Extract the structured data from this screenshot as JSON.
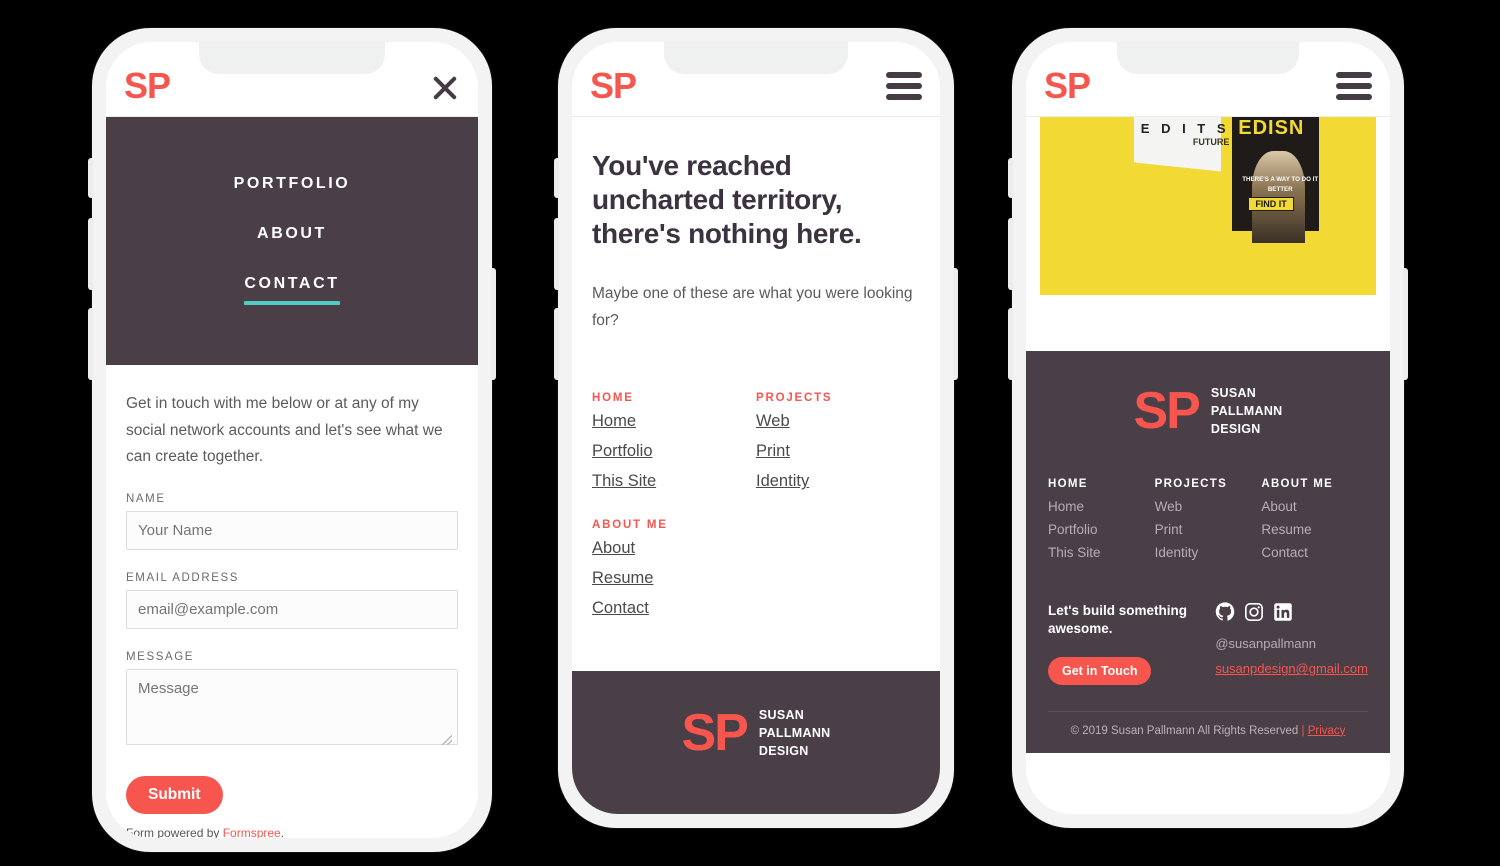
{
  "brand": {
    "logo": "SP",
    "accent": "#f7564f",
    "dark": "#4a3e47",
    "teal": "#4ecdc4",
    "name_lines": [
      "SUSAN",
      "PALLMANN",
      "DESIGN"
    ]
  },
  "phone1": {
    "header": {
      "logo": "SP",
      "close_icon": "close-icon"
    },
    "nav": {
      "items": [
        {
          "label": "PORTFOLIO",
          "active": false
        },
        {
          "label": "ABOUT",
          "active": false
        },
        {
          "label": "CONTACT",
          "active": true
        }
      ]
    },
    "contact": {
      "intro": "Get in touch with me below or at any of my social network accounts and let's see what we can create together.",
      "fields": [
        {
          "label": "NAME",
          "placeholder": "Your Name",
          "value": "",
          "type": "text"
        },
        {
          "label": "EMAIL ADDRESS",
          "placeholder": "email@example.com",
          "value": "",
          "type": "email"
        },
        {
          "label": "MESSAGE",
          "placeholder": "Message",
          "value": "",
          "type": "textarea"
        }
      ],
      "submit_label": "Submit",
      "powered_prefix": "Form powered by ",
      "powered_link": "Formspree",
      "powered_suffix": "."
    }
  },
  "phone2": {
    "header": {
      "logo": "SP",
      "menu_icon": "hamburger-icon"
    },
    "heading": "You've reached uncharted territory, there's nothing here.",
    "subheading": "Maybe one of these are what you were looking for?",
    "link_groups": [
      {
        "title": "HOME",
        "links": [
          "Home",
          "Portfolio",
          "This Site"
        ]
      },
      {
        "title": "PROJECTS",
        "links": [
          "Web",
          "Print",
          "Identity"
        ]
      },
      {
        "title": "ABOUT ME",
        "links": [
          "About",
          "Resume",
          "Contact"
        ]
      }
    ],
    "footer": {
      "logo": "SP",
      "name_lines": [
        "SUSAN",
        "PALLMANN",
        "DESIGN"
      ]
    }
  },
  "phone3": {
    "header": {
      "logo": "SP",
      "menu_icon": "hamburger-icon"
    },
    "hero": {
      "alt": "brochure-mockup",
      "bg_color": "#f2d933",
      "text_edits": "E D I T S",
      "text_edisn": "EDISN",
      "text_future": "FUTURE",
      "caption": "THERE'S A WAY TO DO IT BETTER",
      "badge": "FIND IT"
    },
    "footer": {
      "logo": "SP",
      "name_lines": [
        "SUSAN",
        "PALLMANN",
        "DESIGN"
      ],
      "columns": [
        {
          "title": "HOME",
          "links": [
            "Home",
            "Portfolio",
            "This Site"
          ]
        },
        {
          "title": "PROJECTS",
          "links": [
            "Web",
            "Print",
            "Identity"
          ]
        },
        {
          "title": "ABOUT ME",
          "links": [
            "About",
            "Resume",
            "Contact"
          ]
        }
      ],
      "cta_tagline": "Let's build something awesome.",
      "cta_button": "Get in Touch",
      "socials": [
        {
          "name": "github-icon",
          "label": "GitHub"
        },
        {
          "name": "instagram-icon",
          "label": "Instagram"
        },
        {
          "name": "linkedin-icon",
          "label": "LinkedIn"
        }
      ],
      "handle": "@susanpallmann",
      "email": "susanpdesign@gmail.com",
      "copyright": "© 2019 Susan Pallmann All Rights Reserved",
      "separator": "|",
      "privacy_label": "Privacy"
    }
  }
}
